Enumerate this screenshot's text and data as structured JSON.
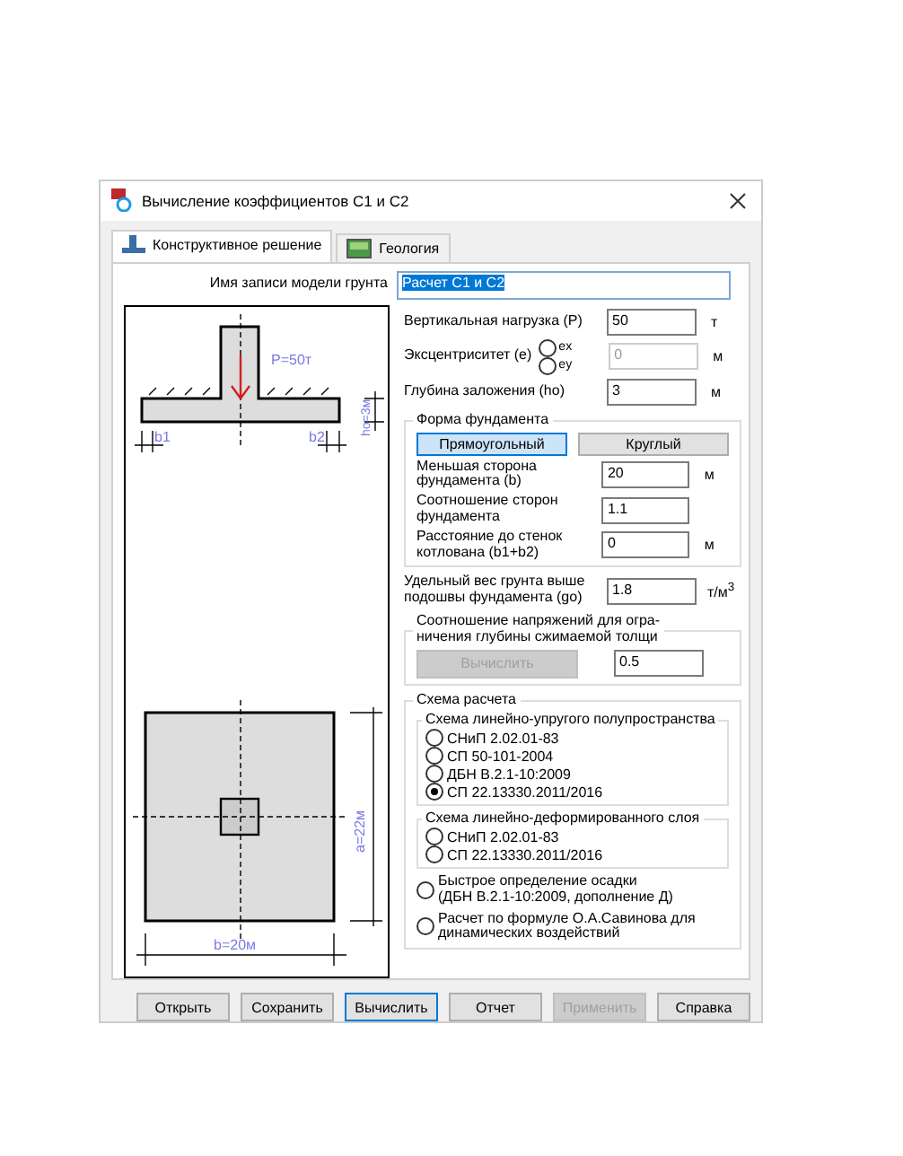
{
  "window": {
    "title": "Вычисление коэффициентов С1 и С2"
  },
  "tabs": [
    {
      "label": "Конструктивное решение",
      "selected": true,
      "kind": "footing"
    },
    {
      "label": "Геология",
      "selected": false,
      "kind": "map"
    }
  ],
  "model_name": {
    "label": "Имя записи модели грунта",
    "value": "Расчет С1 и С2"
  },
  "load": {
    "label": "Вертикальная нагрузка (Р)",
    "value": "50",
    "unit": "т"
  },
  "eccentricity": {
    "label": "Эксцентриситет (е)",
    "options": [
      {
        "label": "ex",
        "selected": false
      },
      {
        "label": "ey",
        "selected": false
      }
    ],
    "value": "0",
    "unit": "м",
    "disabled": true
  },
  "depth": {
    "label": "Глубина заложения (ho)",
    "value": "3",
    "unit": "м"
  },
  "shape": {
    "title": "Форма фундамента",
    "buttons": [
      {
        "label": "Прямоугольный",
        "selected": true
      },
      {
        "label": "Круглый",
        "selected": false
      }
    ],
    "fields": [
      {
        "label": "Меньшая сторона фундамента (b)",
        "value": "20",
        "unit": "м"
      },
      {
        "label": "Соотношение сторон фундамента",
        "value": "1.1"
      },
      {
        "label": "Расстояние до стенок котлована (b1+b2)",
        "value": "0",
        "unit": "м"
      }
    ]
  },
  "unit_weight": {
    "label": "Удельный вес грунта выше подошвы фундамента (go)",
    "value": "1.8",
    "unit": "т/м$^{3}$"
  },
  "stress_ratio": {
    "title": "Соотношение напряжений для огра-\nничения глубины сжимаемой толщи",
    "button": {
      "label": "Вычислить",
      "disabled": true
    },
    "value": "0.5"
  },
  "scheme": {
    "title": "Схема расчета",
    "groups": [
      {
        "title": "Схема линейно-упругого полупространства",
        "options": [
          {
            "label": "СНиП 2.02.01-83",
            "selected": false
          },
          {
            "label": "СП 50-101-2004",
            "selected": false
          },
          {
            "label": "ДБН В.2.1-10:2009",
            "selected": false
          },
          {
            "label": "СП 22.13330.2011/2016",
            "selected": true
          }
        ]
      },
      {
        "title": "Схема линейно-деформированного слоя",
        "options": [
          {
            "label": "СНиП 2.02.01-83",
            "selected": false
          },
          {
            "label": "СП 22.13330.2011/2016",
            "selected": false
          }
        ]
      }
    ],
    "extra_options": [
      {
        "label": "Быстрое определение осадки\n(ДБН В.2.1-10:2009, дополнение Д)",
        "selected": false
      },
      {
        "label": "Расчет по формуле О.А.Савинова для\nдинамических воздействий",
        "selected": false
      }
    ]
  },
  "drawing": {
    "load_label": "P=50т",
    "b1": "b1",
    "b2": "b2",
    "depth_label": "ho=3м",
    "a_label": "a=22м",
    "b_label": "b=20м"
  },
  "buttons": [
    {
      "label": "Открыть",
      "disabled": false,
      "default": false
    },
    {
      "label": "Сохранить",
      "disabled": false,
      "default": false
    },
    {
      "label": "Вычислить",
      "disabled": false,
      "default": true
    },
    {
      "label": "Отчет",
      "disabled": false,
      "default": false
    },
    {
      "label": "Применить",
      "disabled": true,
      "default": false
    },
    {
      "label": "Справка",
      "disabled": false,
      "default": false
    }
  ]
}
